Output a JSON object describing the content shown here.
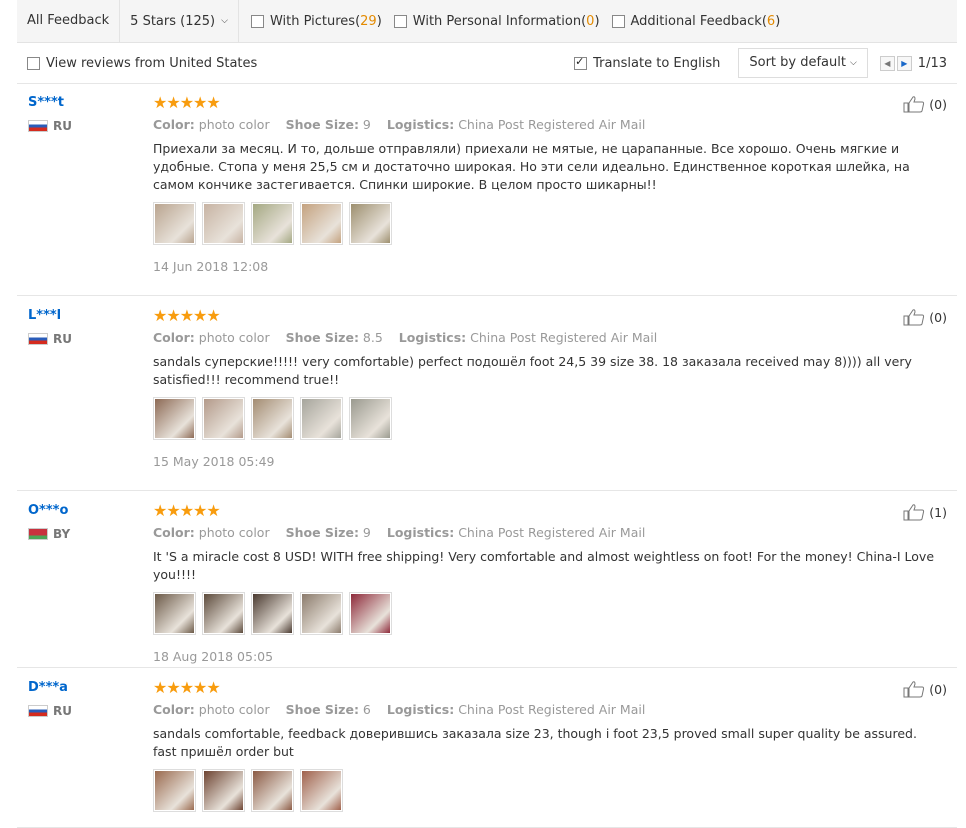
{
  "topbar": {
    "all_feedback": "All Feedback",
    "stars_select": "5 Stars (125)",
    "filters": [
      {
        "label": "With Pictures",
        "count": "29"
      },
      {
        "label": "With Personal Information",
        "count": "0"
      },
      {
        "label": "Additional Feedback",
        "count": "6"
      }
    ]
  },
  "subbar": {
    "us_reviews": "View reviews from United States",
    "translate": "Translate to English",
    "sort": "Sort by default",
    "page": "1/13"
  },
  "labels": {
    "color": "Color:",
    "shoe_size": "Shoe Size:",
    "logistics": "Logistics:"
  },
  "reviews": [
    {
      "user": "S***t",
      "country": "RU",
      "stars": "★★★★★",
      "color": "photo color",
      "shoe_size": "9",
      "logistics": "China Post Registered Air Mail",
      "text": "Приехали за месяц. И то, дольше отправляли) приехали не мятые, не царапанные. Все хорошо. Очень мягкие и удобные. Стопа у меня 25,5 см и достаточно широкая. Но эти сели идеально. Единственное короткая шлейка, на самом кончике застегивается. Спинки широкие. В целом просто шикарны!!",
      "date": "14 Jun 2018 12:08",
      "helpful": "(0)"
    },
    {
      "user": "L***l",
      "country": "RU",
      "stars": "★★★★★",
      "color": "photo color",
      "shoe_size": "8.5",
      "logistics": "China Post Registered Air Mail",
      "text": "sandals суперские!!!!! very comfortable) perfect подошёл foot 24,5 39 size 38. 18 заказала received may 8)))) all very satisfied!!! recommend true!!",
      "date": "15 May 2018 05:49",
      "helpful": "(0)"
    },
    {
      "user": "O***o",
      "country": "BY",
      "stars": "★★★★★",
      "color": "photo color",
      "shoe_size": "9",
      "logistics": "China Post Registered Air Mail",
      "text": "It 'S a miracle cost 8 USD! WITH free shipping! Very comfortable and almost weightless on foot! For the money! China-I Love you!!!!",
      "date": "18 Aug 2018 05:05",
      "helpful": "(1)"
    },
    {
      "user": "D***a",
      "country": "RU",
      "stars": "★★★★★",
      "color": "photo color",
      "shoe_size": "6",
      "logistics": "China Post Registered Air Mail",
      "text": "sandals comfortable, feedback доверившись заказала size 23, though i foot 23,5 proved small super quality be assured. fast пришёл order but",
      "date": "",
      "helpful": "(0)"
    }
  ]
}
